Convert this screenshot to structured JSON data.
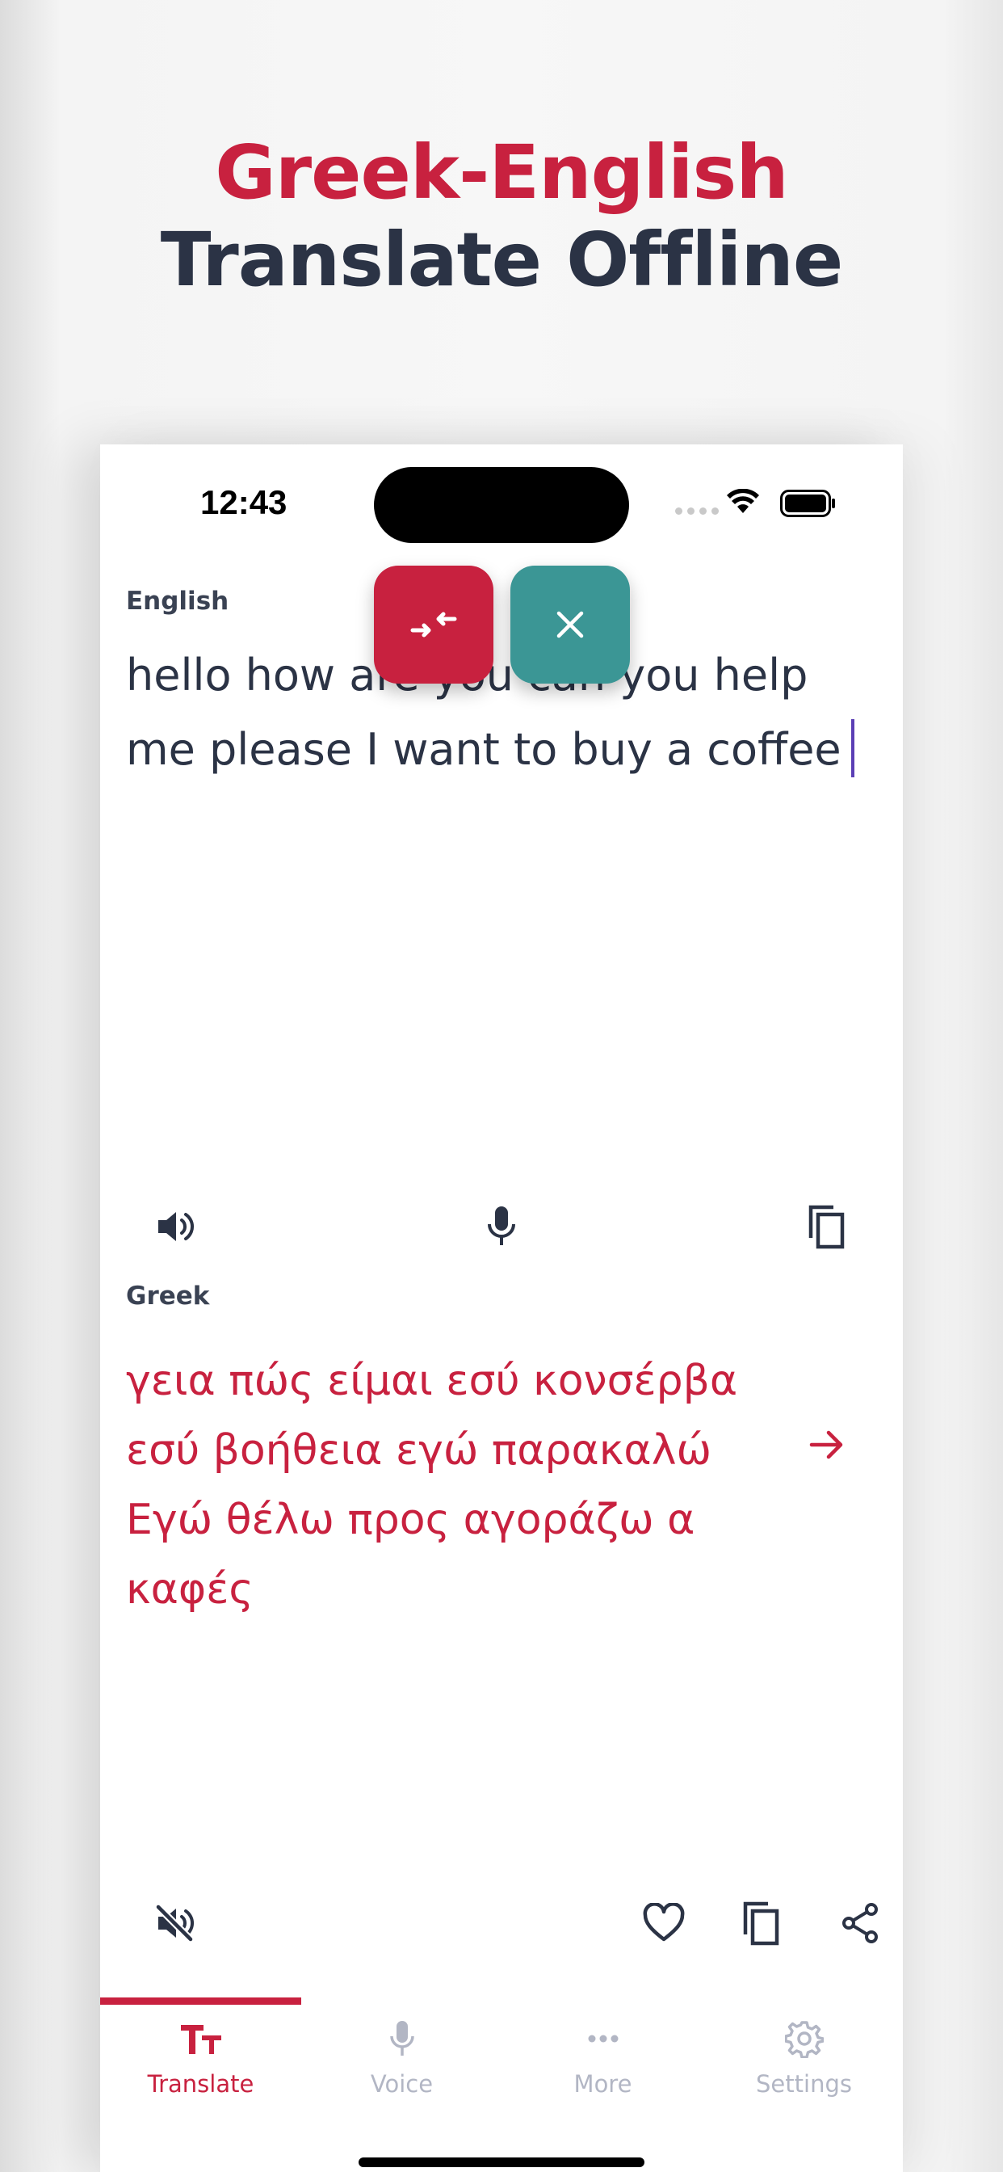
{
  "promo": {
    "title_line1": "Greek-English",
    "title_line2": "Translate Offline"
  },
  "status_bar": {
    "time": "12:43"
  },
  "source": {
    "language": "English",
    "text": "hello how are you can you help me please I want to buy a coffee"
  },
  "target": {
    "language": "Greek",
    "text": "γεια πώς είμαι εσύ κονσέρβα εσύ βοήθεια εγώ παρακαλώ Εγώ θέλω προς αγοράζω α καφές"
  },
  "tabs": [
    {
      "label": "Translate",
      "icon": "text-size-icon",
      "active": true
    },
    {
      "label": "Voice",
      "icon": "microphone-icon",
      "active": false
    },
    {
      "label": "More",
      "icon": "more-dots-icon",
      "active": false
    },
    {
      "label": "Settings",
      "icon": "gear-icon",
      "active": false
    }
  ],
  "colors": {
    "accent": "#c8213f",
    "teal": "#3b9695",
    "text_dark": "#2b3345",
    "inactive": "#b2b6c4"
  }
}
